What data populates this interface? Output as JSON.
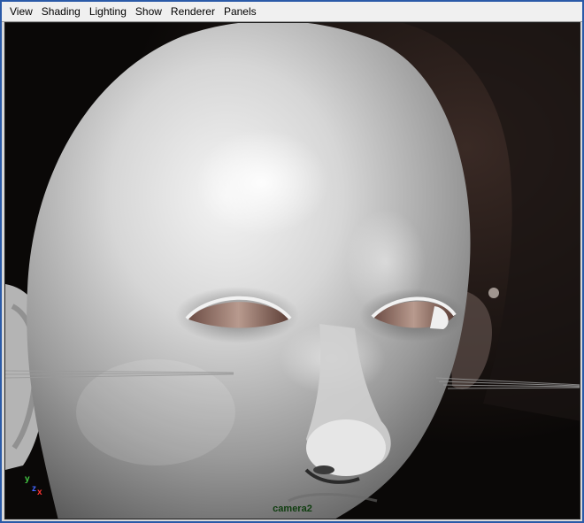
{
  "menu": {
    "items": [
      {
        "label": "View"
      },
      {
        "label": "Shading"
      },
      {
        "label": "Lighting"
      },
      {
        "label": "Show"
      },
      {
        "label": "Renderer"
      },
      {
        "label": "Panels"
      }
    ]
  },
  "viewport": {
    "camera_label": "camera2",
    "axis": {
      "y": "y",
      "z": "z",
      "x": "x"
    },
    "colors": {
      "background": "#0b0b0b",
      "skin": "#c8c8c8",
      "axis_x": "#ff3333",
      "axis_y": "#44cc44",
      "axis_z": "#4466ff",
      "camera_label": "#0f3d0f"
    }
  }
}
